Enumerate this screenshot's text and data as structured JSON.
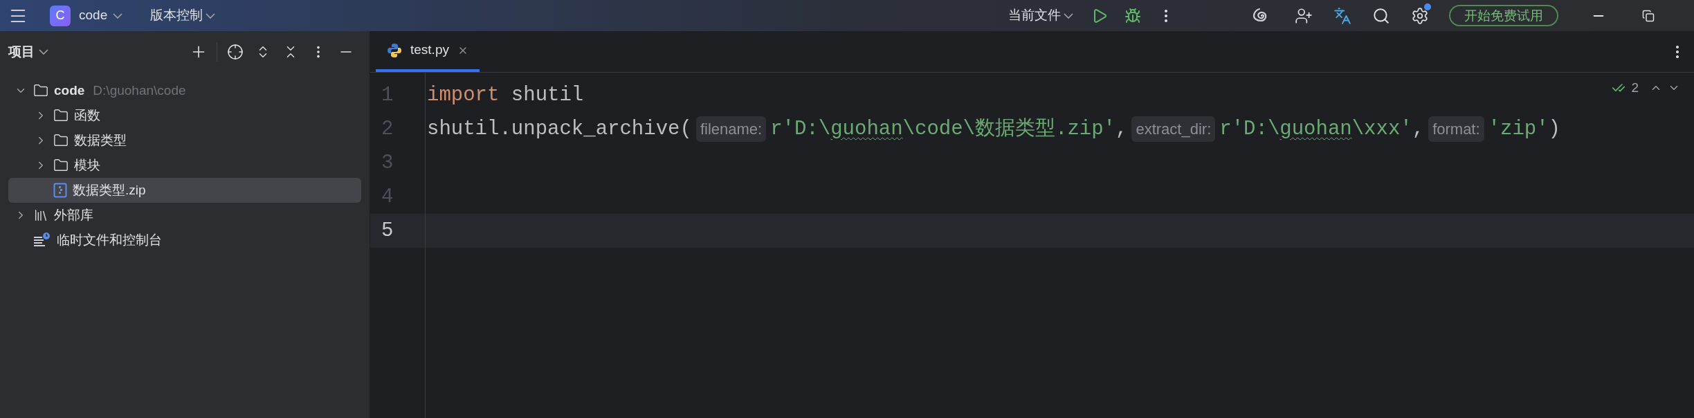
{
  "top_bar": {
    "project": {
      "badge": "C",
      "name": "code"
    },
    "vcs": "版本控制",
    "run_config": "当前文件",
    "trial_button": "开始免费试用",
    "settings_notification": true
  },
  "sidebar": {
    "title": "项目",
    "tree": [
      {
        "name": "code",
        "path": "D:\\guohan\\code",
        "kind": "folder",
        "bold": true,
        "expanded": true,
        "selected": false,
        "children": [
          {
            "name": "函数",
            "kind": "folder",
            "bold": false,
            "expanded": false,
            "selected": false
          },
          {
            "name": "数据类型",
            "kind": "folder",
            "bold": false,
            "expanded": false,
            "selected": false
          },
          {
            "name": "模块",
            "kind": "folder",
            "bold": false,
            "expanded": false,
            "selected": false
          },
          {
            "name": "数据类型.zip",
            "kind": "zip",
            "bold": false,
            "selected": true
          }
        ]
      },
      {
        "name": "外部库",
        "kind": "library",
        "bold": false,
        "expanded": false,
        "selected": false
      },
      {
        "name": "临时文件和控制台",
        "kind": "scratches",
        "bold": false,
        "selected": false
      }
    ]
  },
  "editor": {
    "tabs": [
      {
        "label": "test.py",
        "selected": true
      }
    ],
    "inspections": "2",
    "lines": [
      {
        "number": "1",
        "current": false,
        "tokens": [
          {
            "kind": "keyword",
            "text": "import"
          },
          {
            "kind": "plain",
            "text": " shutil"
          }
        ]
      },
      {
        "number": "2",
        "current": false,
        "tokens": [
          {
            "kind": "plain",
            "text": "shutil.unpack_archive("
          },
          {
            "kind": "hint",
            "text": "filename:"
          },
          {
            "kind": "string",
            "text": "r'D:\\"
          },
          {
            "kind": "string_typo",
            "text": "guohan"
          },
          {
            "kind": "string",
            "text": "\\code\\数据类型.zip'"
          },
          {
            "kind": "plain",
            "text": ","
          },
          {
            "kind": "hint",
            "text": "extract_dir:"
          },
          {
            "kind": "string",
            "text": "r'D:\\"
          },
          {
            "kind": "string_typo",
            "text": "guohan"
          },
          {
            "kind": "string",
            "text": "\\xxx'"
          },
          {
            "kind": "plain",
            "text": ","
          },
          {
            "kind": "hint",
            "text": "format:"
          },
          {
            "kind": "string",
            "text": "'zip'"
          },
          {
            "kind": "plain",
            "text": ")"
          }
        ]
      },
      {
        "number": "3",
        "current": false
      },
      {
        "number": "4",
        "current": false
      },
      {
        "number": "5",
        "current": true
      }
    ]
  }
}
